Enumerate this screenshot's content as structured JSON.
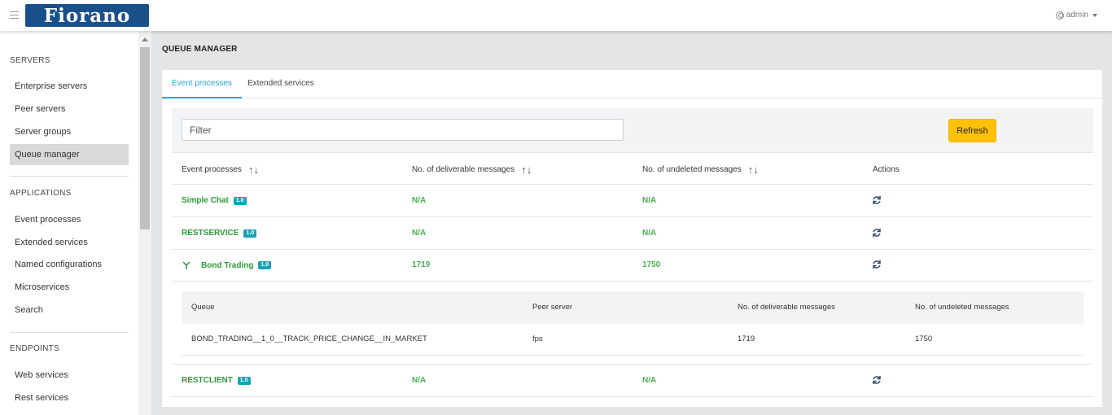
{
  "header": {
    "logo_text": "Fiorano",
    "user": "admin"
  },
  "sidebar": {
    "sections": [
      {
        "title": "SERVERS",
        "items": [
          "Enterprise servers",
          "Peer servers",
          "Server groups",
          "Queue manager"
        ]
      },
      {
        "title": "APPLICATIONS",
        "items": [
          "Event processes",
          "Extended services",
          "Named configurations",
          "Microservices",
          "Search"
        ]
      },
      {
        "title": "ENDPOINTS",
        "items": [
          "Web services",
          "Rest services"
        ]
      }
    ],
    "active_item": "Queue manager"
  },
  "page": {
    "title": "QUEUE MANAGER",
    "tabs": [
      "Event processes",
      "Extended services"
    ],
    "active_tab": "Event processes"
  },
  "toolbar": {
    "filter_placeholder": "Filter",
    "refresh_label": "Refresh"
  },
  "table": {
    "columns": [
      "Event processes",
      "No. of deliverable messages",
      "No. of undeleted messages",
      "Actions"
    ],
    "rows": [
      {
        "name": "Simple Chat",
        "version": "1.0",
        "deliverable": "N/A",
        "undeleted": "N/A",
        "expanded": false
      },
      {
        "name": "RESTSERVICE",
        "version": "1.0",
        "deliverable": "N/A",
        "undeleted": "N/A",
        "expanded": false
      },
      {
        "name": "Bond Trading",
        "version": "1.0",
        "deliverable": "1719",
        "undeleted": "1750",
        "expanded": true
      },
      {
        "name": "RESTCLIENT",
        "version": "1.0",
        "deliverable": "N/A",
        "undeleted": "N/A",
        "expanded": false
      }
    ]
  },
  "subtable": {
    "columns": [
      "Queue",
      "Peer server",
      "No. of deliverable messages",
      "No. of undeleted messages"
    ],
    "rows": [
      {
        "queue": "BOND_TRADING__1_0__TRACK_PRICE_CHANGE__IN_MARKET",
        "peer": "fps",
        "deliverable": "1719",
        "undeleted": "1750"
      }
    ]
  },
  "colors": {
    "accent": "#20a8d8",
    "success": "#4caf50",
    "warning": "#ffc107",
    "badge": "#17a2b8",
    "brand": "#1b4f8a"
  },
  "icons": {
    "menu": "hamburger-icon",
    "user": "user-circle-icon",
    "sort": "sort-icon",
    "refresh_row": "refresh-icon",
    "expand": "collapse-arrow-icon"
  }
}
